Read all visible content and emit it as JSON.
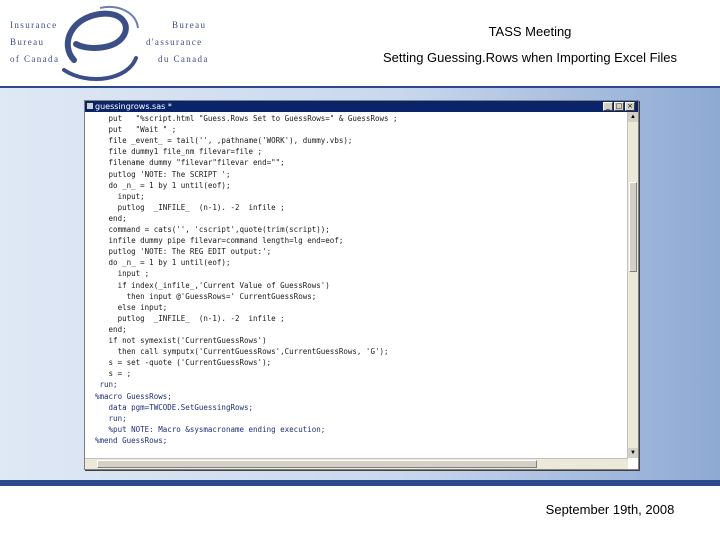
{
  "logo": {
    "left_lines": [
      "Insurance",
      "Bureau",
      "of Canada"
    ],
    "right_lines": [
      "Bureau",
      "d'assurance",
      "du Canada"
    ]
  },
  "header": {
    "title": "TASS Meeting",
    "subtitle": "Setting Guessing.Rows when Importing Excel Files"
  },
  "editor": {
    "window_title": "guessingrows.sas *",
    "buttons": {
      "minimize": "_",
      "maximize": "□",
      "close": "×"
    },
    "lines": [
      "   put   \"%script.html \"Guess.Rows Set to GuessRows=\" & GuessRows ;",
      "   put   \"Wait \" ;",
      "   file _event_ = tail('', ,pathname('WORK'), dummy.vbs);",
      "   file dummy1 file_nm filevar=file ;",
      "   filename dummy \"filevar\"filevar end=\"\";",
      "   putlog 'NOTE: The SCRIPT ';",
      "   do _n_ = 1 by 1 until(eof);",
      "     input;",
      "     putlog  _INFILE_  (n-1). -2  infile ;",
      "   end;",
      "   command = cats('', 'cscript',quote(trim(script));",
      "   infile dummy pipe filevar=command length=lg end=eof;",
      "   putlog 'NOTE: The REG EDIT output:';",
      "   do _n_ = 1 by 1 until(eof);",
      "     input ;",
      "     if index(_infile_,'Current Value of GuessRows')",
      "       then input @'GuessRows=' CurrentGuessRows;",
      "     else input;",
      "     putlog  _INFILE_  (n-1). -2  infile ;",
      "   end;",
      "   if not symexist('CurrentGuessRows')",
      "     then call symputx('CurrentGuessRows',CurrentGuessRows, 'G');",
      "   s = set -quote ('CurrentGuessRows');",
      "   s = ;",
      " run;",
      "%macro GuessRows;",
      "   data pgm=TWCODE.SetGuessingRows;",
      "   run;",
      "   %put NOTE: Macro &sysmacroname ending execution;",
      "%mend GuessRows;"
    ]
  },
  "footer": {
    "date": "September 19th, 2008"
  },
  "colors": {
    "brand_blue": "#3b4f86",
    "band_dark": "#2a4a8c",
    "window_title_bg": "#0a246a"
  }
}
